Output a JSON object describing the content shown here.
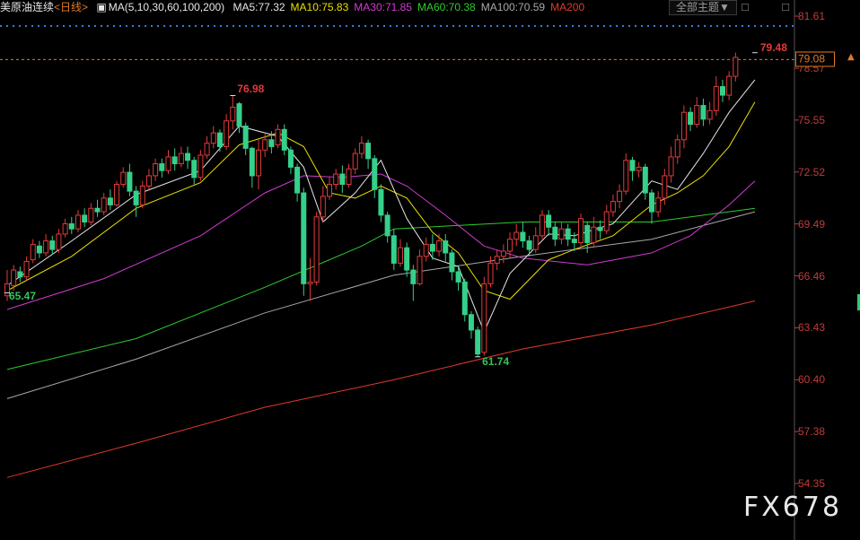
{
  "header": {
    "symbol": "美原油连续",
    "period": "<日线>",
    "ma_spec": "MA(5,10,30,60,100,200)",
    "ma_values": [
      {
        "text": "MA5:77.32",
        "color": "#e6e6e6"
      },
      {
        "text": "MA10:75.83",
        "color": "#e8e000"
      },
      {
        "text": "MA30:71.85",
        "color": "#d23ad2"
      },
      {
        "text": "MA60:70.38",
        "color": "#2ecc2e"
      },
      {
        "text": "MA100:70.59",
        "color": "#a8a8a8"
      },
      {
        "text": "MA200",
        "color": "#e03a2a"
      }
    ],
    "theme_label": "全部主题▼",
    "close_glyph": "□",
    "close_glyph2": "□"
  },
  "y_axis": {
    "ticks": [
      "81.61",
      "78.57",
      "75.55",
      "72.52",
      "69.49",
      "66.46",
      "63.43",
      "60.40",
      "57.38",
      "54.35"
    ],
    "last_price": "79.08"
  },
  "annotations": {
    "high": "76.98",
    "low_left": "65.47",
    "low": "61.74",
    "recent_high": "79.48"
  },
  "watermark": "FX678",
  "chart_data": {
    "type": "candlestick",
    "colors": {
      "up": "#e23b3b",
      "down": "#35d08a",
      "ma5": "#e6e6e6",
      "ma10": "#e8e000",
      "ma30": "#d23ad2",
      "ma60": "#2ecc2e",
      "ma100": "#a8a8a8",
      "ma200": "#e03a2a",
      "last_line": "#e07a2a"
    },
    "ylim": [
      54.35,
      81.61
    ],
    "candles": [
      [
        65.3,
        66.0,
        65.0,
        66.8
      ],
      [
        65.9,
        66.8,
        65.6,
        67.1
      ],
      [
        66.7,
        66.4,
        66.1,
        67.0
      ],
      [
        66.4,
        67.3,
        66.2,
        67.6
      ],
      [
        67.4,
        68.3,
        67.2,
        68.6
      ],
      [
        68.2,
        67.8,
        67.5,
        68.5
      ],
      [
        67.8,
        68.5,
        67.6,
        68.9
      ],
      [
        68.5,
        68.0,
        67.7,
        68.8
      ],
      [
        68.0,
        68.9,
        67.8,
        69.2
      ],
      [
        68.9,
        69.5,
        68.7,
        69.8
      ],
      [
        69.5,
        69.2,
        68.9,
        69.9
      ],
      [
        69.2,
        70.0,
        69.0,
        70.3
      ],
      [
        70.0,
        69.6,
        69.3,
        70.4
      ],
      [
        69.6,
        70.4,
        69.4,
        70.7
      ],
      [
        70.4,
        70.2,
        69.9,
        70.9
      ],
      [
        70.2,
        71.0,
        70.0,
        71.3
      ],
      [
        71.0,
        70.6,
        70.3,
        71.5
      ],
      [
        70.6,
        71.8,
        70.5,
        72.0
      ],
      [
        71.8,
        72.5,
        71.6,
        72.8
      ],
      [
        72.5,
        71.4,
        71.1,
        73.0
      ],
      [
        71.4,
        70.6,
        69.9,
        71.7
      ],
      [
        70.6,
        71.7,
        70.4,
        72.0
      ],
      [
        71.7,
        72.3,
        71.5,
        72.7
      ],
      [
        72.3,
        73.0,
        72.0,
        73.3
      ],
      [
        73.0,
        72.6,
        72.2,
        73.3
      ],
      [
        72.6,
        73.4,
        72.4,
        73.8
      ],
      [
        73.4,
        73.0,
        72.6,
        73.9
      ],
      [
        73.0,
        73.6,
        72.8,
        74.0
      ],
      [
        73.6,
        73.2,
        72.7,
        74.0
      ],
      [
        73.2,
        72.2,
        71.8,
        73.4
      ],
      [
        72.2,
        73.5,
        72.0,
        73.8
      ],
      [
        73.5,
        74.2,
        73.3,
        74.6
      ],
      [
        74.2,
        74.8,
        73.9,
        75.2
      ],
      [
        74.8,
        74.0,
        73.7,
        75.0
      ],
      [
        74.0,
        75.5,
        73.8,
        75.9
      ],
      [
        75.5,
        76.3,
        75.0,
        77.0
      ],
      [
        76.5,
        75.2,
        74.8,
        76.6
      ],
      [
        75.2,
        73.9,
        73.5,
        75.4
      ],
      [
        73.9,
        72.3,
        71.6,
        74.0
      ],
      [
        72.3,
        73.8,
        71.5,
        74.4
      ],
      [
        73.8,
        74.4,
        73.4,
        74.8
      ],
      [
        74.4,
        74.0,
        73.6,
        74.9
      ],
      [
        74.1,
        75.0,
        73.9,
        75.3
      ],
      [
        75.0,
        73.8,
        73.5,
        75.3
      ],
      [
        73.8,
        72.8,
        72.4,
        74.0
      ],
      [
        72.8,
        71.3,
        70.8,
        73.0
      ],
      [
        71.3,
        66.0,
        65.3,
        71.6
      ],
      [
        66.0,
        66.1,
        65.0,
        67.5
      ],
      [
        66.1,
        69.9,
        65.9,
        70.2
      ],
      [
        69.9,
        71.1,
        69.6,
        71.7
      ],
      [
        71.1,
        71.8,
        70.9,
        72.2
      ],
      [
        71.8,
        72.4,
        71.5,
        72.7
      ],
      [
        72.4,
        71.8,
        71.3,
        72.9
      ],
      [
        71.8,
        72.7,
        71.6,
        73.0
      ],
      [
        72.7,
        73.6,
        72.4,
        73.9
      ],
      [
        73.6,
        74.2,
        73.3,
        74.6
      ],
      [
        74.2,
        73.3,
        72.7,
        74.4
      ],
      [
        73.3,
        71.5,
        71.0,
        73.5
      ],
      [
        71.5,
        70.0,
        69.6,
        71.8
      ],
      [
        70.0,
        68.8,
        68.4,
        70.2
      ],
      [
        68.8,
        67.2,
        66.8,
        69.2
      ],
      [
        67.2,
        68.1,
        67.0,
        68.6
      ],
      [
        68.1,
        66.8,
        66.4,
        68.4
      ],
      [
        66.8,
        66.0,
        65.0,
        67.1
      ],
      [
        66.0,
        67.6,
        65.9,
        68.0
      ],
      [
        67.6,
        68.3,
        67.3,
        68.7
      ],
      [
        68.3,
        67.9,
        67.4,
        68.9
      ],
      [
        67.9,
        68.5,
        67.6,
        68.9
      ],
      [
        68.5,
        67.8,
        67.3,
        68.9
      ],
      [
        67.8,
        66.7,
        66.2,
        68.0
      ],
      [
        66.7,
        66.1,
        65.6,
        67.0
      ],
      [
        66.1,
        64.2,
        63.8,
        66.3
      ],
      [
        64.2,
        63.3,
        62.8,
        64.4
      ],
      [
        63.3,
        61.9,
        61.74,
        63.5
      ],
      [
        62.0,
        66.0,
        61.8,
        66.4
      ],
      [
        66.0,
        67.2,
        65.8,
        67.6
      ],
      [
        67.2,
        67.6,
        66.8,
        68.0
      ],
      [
        67.6,
        67.9,
        67.2,
        68.3
      ],
      [
        67.9,
        68.6,
        67.5,
        69.0
      ],
      [
        68.6,
        69.0,
        68.2,
        69.5
      ],
      [
        69.0,
        68.5,
        68.1,
        69.6
      ],
      [
        68.5,
        68.0,
        67.6,
        68.8
      ],
      [
        68.0,
        68.8,
        67.8,
        69.3
      ],
      [
        68.8,
        70.0,
        68.6,
        70.3
      ],
      [
        70.0,
        69.3,
        68.8,
        70.3
      ],
      [
        69.3,
        68.6,
        68.2,
        69.6
      ],
      [
        68.6,
        69.2,
        68.3,
        69.6
      ],
      [
        69.2,
        68.6,
        68.2,
        69.5
      ],
      [
        68.6,
        68.4,
        67.9,
        69.0
      ],
      [
        68.4,
        69.8,
        68.2,
        70.1
      ],
      [
        69.4,
        68.4,
        67.8,
        69.6
      ],
      [
        68.4,
        69.3,
        68.1,
        69.9
      ],
      [
        69.3,
        69.1,
        68.6,
        69.7
      ],
      [
        69.1,
        70.2,
        68.9,
        70.6
      ],
      [
        70.2,
        70.8,
        69.9,
        71.2
      ],
      [
        70.8,
        71.4,
        70.4,
        71.8
      ],
      [
        71.4,
        73.2,
        71.2,
        73.6
      ],
      [
        73.2,
        72.6,
        72.0,
        73.4
      ],
      [
        72.6,
        72.8,
        72.2,
        73.1
      ],
      [
        72.8,
        71.3,
        70.9,
        73.0
      ],
      [
        71.3,
        70.2,
        69.5,
        71.5
      ],
      [
        70.2,
        71.0,
        69.9,
        71.4
      ],
      [
        71.0,
        72.3,
        70.6,
        72.7
      ],
      [
        72.3,
        73.4,
        71.9,
        74.0
      ],
      [
        73.4,
        74.4,
        73.0,
        74.7
      ],
      [
        74.4,
        76.0,
        73.9,
        76.4
      ],
      [
        76.0,
        75.3,
        74.9,
        76.3
      ],
      [
        75.3,
        76.4,
        75.1,
        76.9
      ],
      [
        76.4,
        75.6,
        75.2,
        76.8
      ],
      [
        75.6,
        76.1,
        75.3,
        76.6
      ],
      [
        76.1,
        77.5,
        75.8,
        78.1
      ],
      [
        77.5,
        77.0,
        76.6,
        77.9
      ],
      [
        77.0,
        78.1,
        76.7,
        78.4
      ],
      [
        78.1,
        79.2,
        77.8,
        79.48
      ]
    ],
    "ma_lines": {
      "ma5": [
        [
          0,
          65.9
        ],
        [
          10,
          68.5
        ],
        [
          20,
          71.2
        ],
        [
          30,
          72.6
        ],
        [
          36,
          75.2
        ],
        [
          42,
          74.6
        ],
        [
          46,
          72.8
        ],
        [
          49,
          69.6
        ],
        [
          54,
          71.3
        ],
        [
          58,
          73.2
        ],
        [
          62,
          69.8
        ],
        [
          66,
          67.5
        ],
        [
          70,
          67.0
        ],
        [
          74,
          63.2
        ],
        [
          78,
          66.6
        ],
        [
          84,
          68.9
        ],
        [
          88,
          68.8
        ],
        [
          94,
          69.5
        ],
        [
          100,
          72.0
        ],
        [
          104,
          71.5
        ],
        [
          108,
          73.6
        ],
        [
          112,
          76.0
        ],
        [
          116,
          77.9
        ]
      ],
      "ma10": [
        [
          0,
          65.6
        ],
        [
          10,
          67.6
        ],
        [
          20,
          70.4
        ],
        [
          30,
          71.9
        ],
        [
          36,
          74.1
        ],
        [
          42,
          74.8
        ],
        [
          46,
          74.0
        ],
        [
          50,
          71.3
        ],
        [
          54,
          71.0
        ],
        [
          58,
          71.7
        ],
        [
          62,
          71.0
        ],
        [
          66,
          69.0
        ],
        [
          70,
          67.8
        ],
        [
          74,
          65.6
        ],
        [
          78,
          65.1
        ],
        [
          84,
          67.4
        ],
        [
          88,
          68.0
        ],
        [
          94,
          68.8
        ],
        [
          100,
          70.6
        ],
        [
          104,
          71.3
        ],
        [
          108,
          72.3
        ],
        [
          112,
          74.0
        ],
        [
          116,
          76.6
        ]
      ],
      "ma30": [
        [
          0,
          64.5
        ],
        [
          15,
          66.3
        ],
        [
          30,
          68.8
        ],
        [
          40,
          71.3
        ],
        [
          46,
          72.3
        ],
        [
          52,
          72.2
        ],
        [
          58,
          72.4
        ],
        [
          62,
          71.7
        ],
        [
          68,
          70.0
        ],
        [
          74,
          68.2
        ],
        [
          80,
          67.5
        ],
        [
          90,
          67.1
        ],
        [
          100,
          67.8
        ],
        [
          106,
          68.8
        ],
        [
          112,
          70.6
        ],
        [
          116,
          72.0
        ]
      ],
      "ma60": [
        [
          0,
          61.0
        ],
        [
          20,
          62.8
        ],
        [
          40,
          65.8
        ],
        [
          55,
          68.2
        ],
        [
          60,
          69.2
        ],
        [
          80,
          69.6
        ],
        [
          100,
          69.6
        ],
        [
          116,
          70.4
        ]
      ],
      "ma100": [
        [
          0,
          59.3
        ],
        [
          20,
          61.6
        ],
        [
          40,
          64.3
        ],
        [
          60,
          66.5
        ],
        [
          80,
          67.6
        ],
        [
          100,
          68.6
        ],
        [
          116,
          70.2
        ]
      ],
      "ma200": [
        [
          0,
          54.7
        ],
        [
          20,
          56.7
        ],
        [
          40,
          58.8
        ],
        [
          60,
          60.4
        ],
        [
          80,
          62.2
        ],
        [
          100,
          63.6
        ],
        [
          116,
          65.0
        ]
      ]
    }
  }
}
